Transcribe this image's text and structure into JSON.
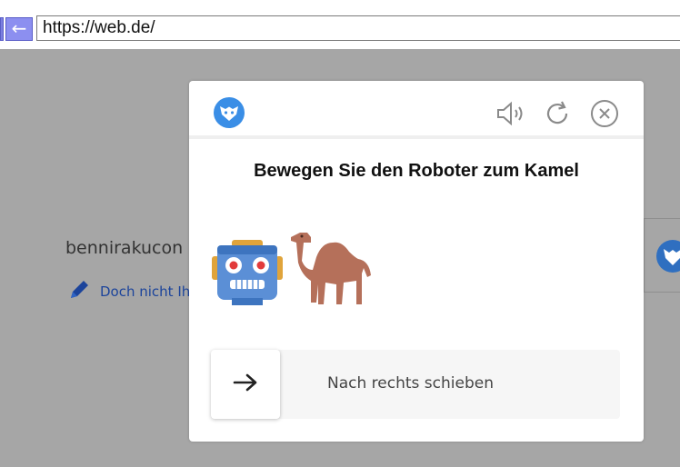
{
  "browser": {
    "back_symbol": "←",
    "url": "https://web.de/"
  },
  "page": {
    "username_text": "bennirakucon",
    "link_text": "Doch nicht Ih"
  },
  "captcha": {
    "title": "Bewegen Sie den Roboter zum Kamel",
    "slider_label": "Nach rechts schieben",
    "icons": [
      "logo-icon",
      "audio-icon",
      "refresh-icon",
      "close-icon",
      "robot-icon",
      "camel-icon",
      "arrow-right-icon"
    ],
    "colors": {
      "brand": "#3a8ee6",
      "track": "#f6f6f6",
      "overlay": "#a6a6a6",
      "robot_blue": "#5b8fd6",
      "camel": "#b5705a"
    },
    "slider_progress": 0
  }
}
